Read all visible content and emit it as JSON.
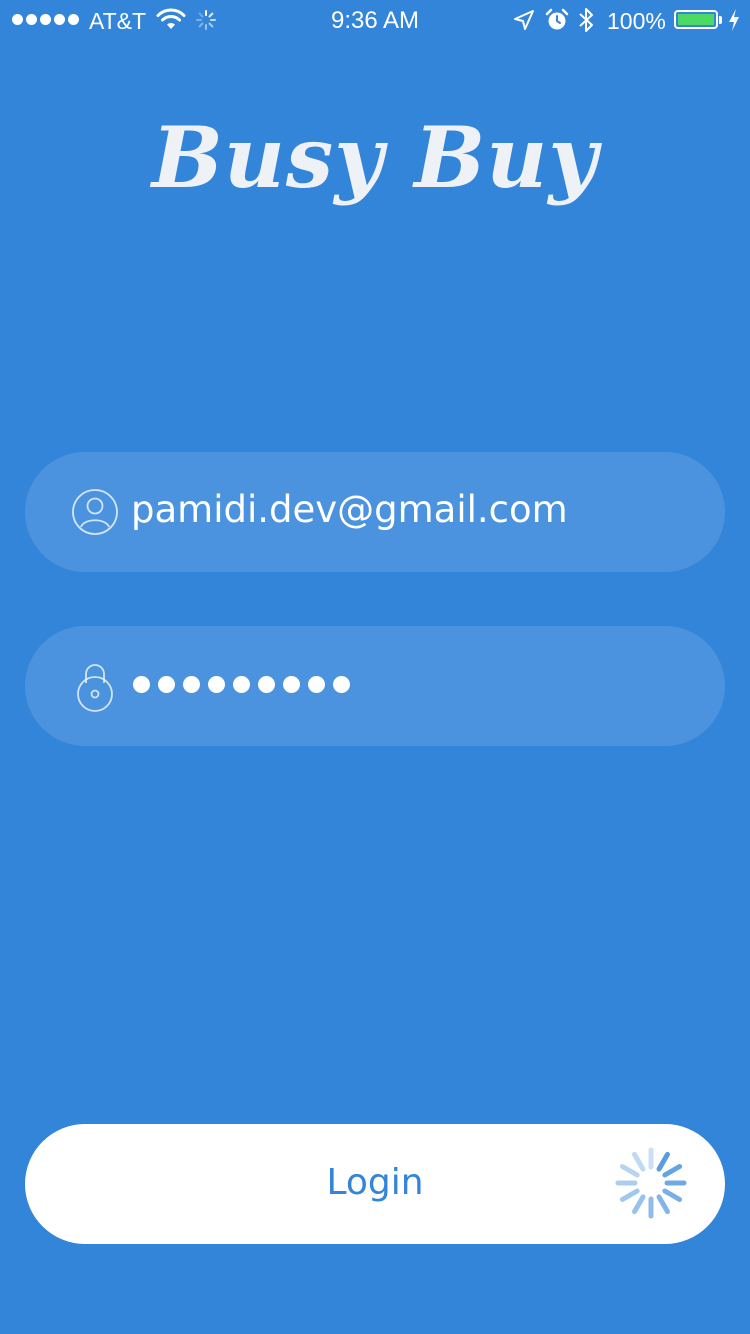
{
  "status_bar": {
    "carrier": "AT&T",
    "time": "9:36 AM",
    "battery_percent": "100%",
    "signal_bars": 5,
    "battery_level": 1.0,
    "icons": [
      "signal-dots-icon",
      "wifi-icon",
      "activity-spinner-icon",
      "location-arrow-icon",
      "alarm-clock-icon",
      "bluetooth-icon",
      "battery-icon",
      "charging-bolt-icon"
    ]
  },
  "app": {
    "logo_text": "Busy Buy"
  },
  "login_form": {
    "email": {
      "value": "pamidi.dev@gmail.com",
      "icon": "user-icon"
    },
    "password": {
      "masked_length": 9,
      "icon": "lock-icon"
    },
    "login_button": {
      "label": "Login",
      "loading_icon": "loading-spinner-icon"
    }
  },
  "colors": {
    "background": "#3385da",
    "field_background": "rgba(255,255,255,0.12)",
    "button_background": "#ffffff",
    "button_text": "#3385da",
    "battery_fill": "#4cd964"
  }
}
